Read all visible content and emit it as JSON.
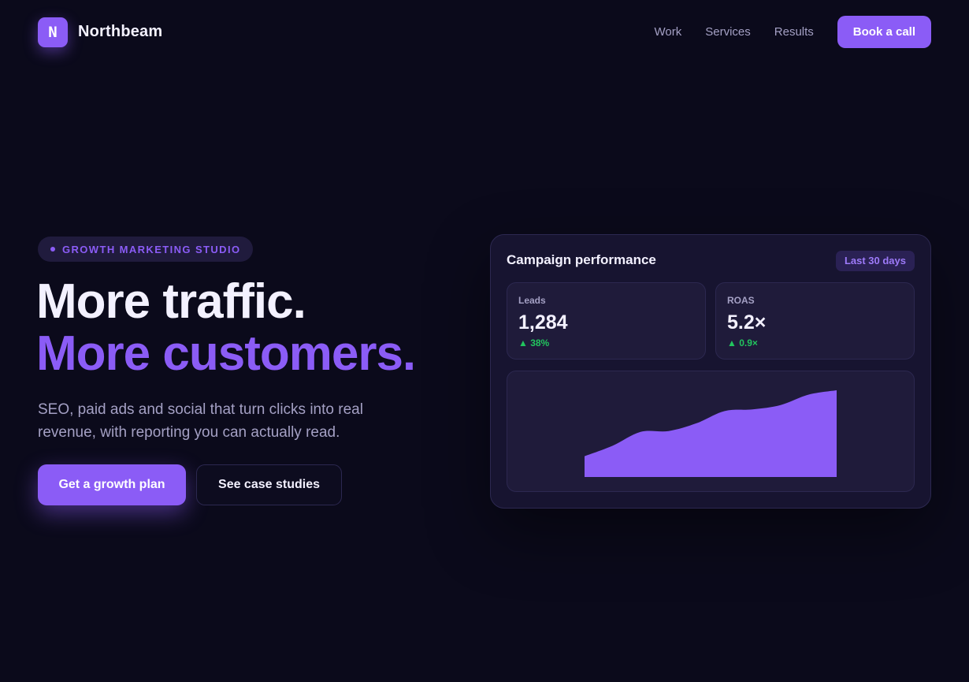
{
  "nav": {
    "logo_letter": "N",
    "brand": "Northbeam",
    "links": [
      "Work",
      "Services",
      "Results"
    ],
    "cta": "Book a call"
  },
  "hero": {
    "badge": "GROWTH MARKETING STUDIO",
    "headline_line1": "More traffic.",
    "headline_line2": "More customers.",
    "subtitle": "SEO, paid ads and social that turn clicks into real revenue, with reporting you can actually read.",
    "primary_cta": "Get a growth plan",
    "secondary_cta": "See case studies"
  },
  "card": {
    "title": "Campaign performance",
    "range": "Last 30 days",
    "stats": [
      {
        "label": "Leads",
        "value": "1,284",
        "delta": "▲ 38%"
      },
      {
        "label": "ROAS",
        "value": "5.2×",
        "delta": "▲ 0.9×"
      }
    ]
  },
  "colors": {
    "background": "#0b0a1b",
    "accent": "#8b5cf6",
    "positive": "#22c55e",
    "muted_text": "#a4a0c4"
  },
  "chart_data": {
    "type": "area",
    "title": "",
    "xlabel": "",
    "ylabel": "",
    "series": [
      {
        "values": [
          24,
          36,
          52,
          53,
          62,
          76,
          78,
          83,
          95,
          100
        ]
      }
    ],
    "ylim": [
      0,
      100
    ],
    "grid": false
  }
}
